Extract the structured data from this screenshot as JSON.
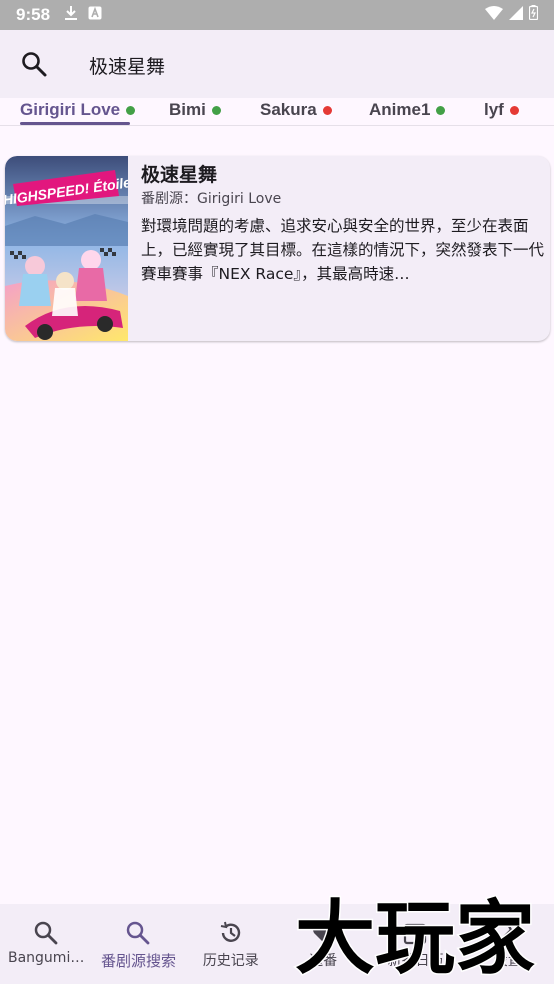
{
  "status_bar": {
    "time": "9:58"
  },
  "search": {
    "query": "极速星舞"
  },
  "source_tabs": [
    {
      "label": "Girigiri Love",
      "status_color": "#43A047",
      "active": true
    },
    {
      "label": "Bimi",
      "status_color": "#43A047",
      "active": false
    },
    {
      "label": "Sakura",
      "status_color": "#E53935",
      "active": false
    },
    {
      "label": "Anime1",
      "status_color": "#43A047",
      "active": false
    },
    {
      "label": "lyf",
      "status_color": "#E53935",
      "active": false
    }
  ],
  "result": {
    "title": "极速星舞",
    "source": "番剧源：Girigiri Love",
    "description": "對環境問題的考慮、追求安心與安全的世界，至少在表面上，已經實現了其目標。在這樣的情況下，突然發表下一代賽車賽事『NEX Race』，其最高時速…",
    "cover_text": "HIGHSPEED! Étoile"
  },
  "bottom_nav": [
    {
      "label": "Bangumi…",
      "icon": "search-icon",
      "active": false
    },
    {
      "label": "番剧源搜索",
      "icon": "search-icon",
      "active": true
    },
    {
      "label": "历史记录",
      "icon": "history-icon",
      "active": false
    },
    {
      "label": "追番",
      "icon": "heart-icon",
      "active": false
    },
    {
      "label": "新番日历",
      "icon": "calendar-icon",
      "active": false
    },
    {
      "label": "设置",
      "icon": "settings-icon",
      "active": false
    }
  ],
  "watermark": {
    "text": "大玩家"
  },
  "colors": {
    "accent": "#65558F",
    "surface": "#F3EDF7",
    "background": "#FEF7FF"
  }
}
